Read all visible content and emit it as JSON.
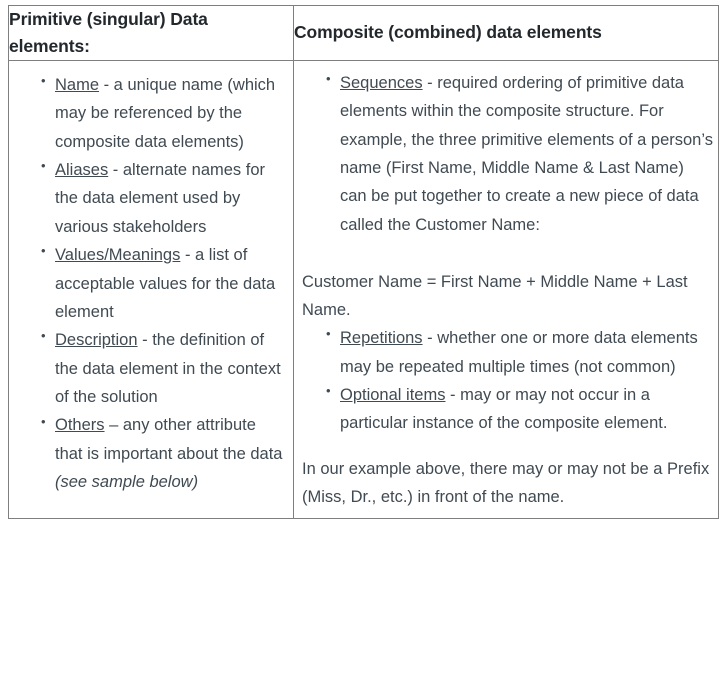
{
  "table": {
    "columns": [
      {
        "header": "Primitive (singular) Data elements:"
      },
      {
        "header": "Composite (combined) data elements"
      }
    ],
    "left_column": {
      "bullets": [
        {
          "term": "Name",
          "rest": " - a unique name (which may be referenced by the composite data elements)"
        },
        {
          "term": "Aliases",
          "rest": " - alternate names for the data element used by various stakeholders"
        },
        {
          "term": "Values/Meanings",
          "rest": " - a list of acceptable values for the data element"
        },
        {
          "term": "Description",
          "rest": " - the definition of the data element in the context of the solution"
        },
        {
          "term": "Others",
          "rest": " – any other attribute that is important about the data ",
          "italic_tail": "(see sample below)"
        }
      ]
    },
    "right_column": {
      "bullets_top": [
        {
          "term": "Sequences",
          "rest": " - required ordering of primitive data elements within the composite structure. For example, the three primitive elements of a person’s name (First Name, Middle Name & Last Name) can be put together to create a new piece of data called the Customer Name:"
        }
      ],
      "formula_paragraph": "Customer Name = First Name + Middle Name + Last Name.",
      "bullets_bottom": [
        {
          "term": "Repetitions",
          "rest": " - whether one or more data elements may be repeated multiple times (not common)"
        },
        {
          "term": "Optional items",
          "rest": " - may or may not occur in a particular instance of the composite element."
        }
      ],
      "closing_paragraph": "In our example above, there may or may not be a Prefix (Miss, Dr., etc.) in front of the name."
    }
  },
  "colors": {
    "text": "#404a52",
    "heading": "#23282d",
    "border": "#7f7f7f",
    "background": "#ffffff"
  }
}
